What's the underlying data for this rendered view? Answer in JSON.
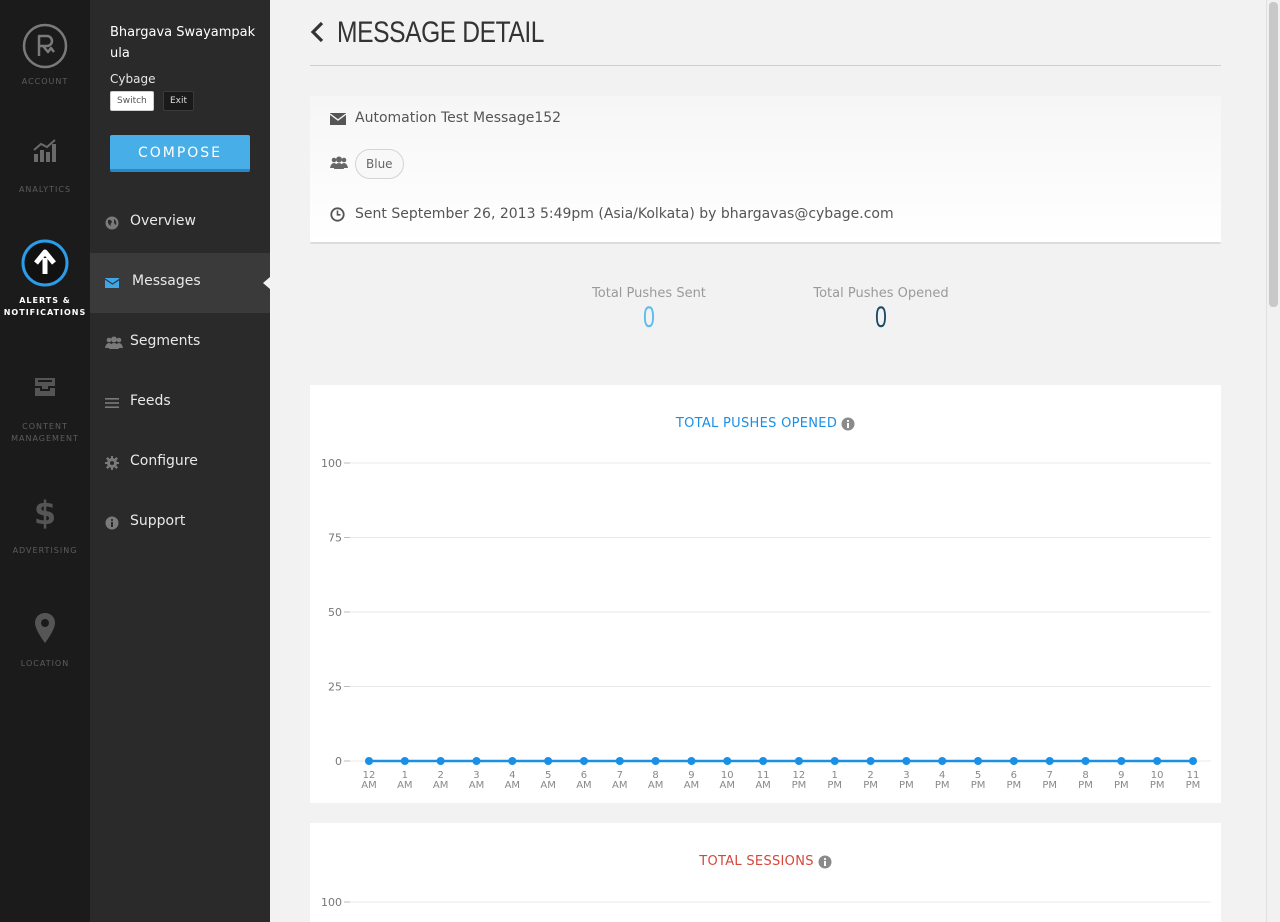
{
  "rail": [
    {
      "label": "Account",
      "icon": "brand-logo-icon",
      "active": false
    },
    {
      "label": "Analytics",
      "icon": "analytics-icon",
      "active": false
    },
    {
      "label": "Alerts &",
      "label2": "Notifications",
      "icon": "upload-arrow-icon",
      "active": true
    },
    {
      "label": "Content",
      "label2": "Management",
      "icon": "inbox-icon",
      "active": false
    },
    {
      "label": "Advertising",
      "icon": "dollar-icon",
      "active": false
    },
    {
      "label": "Location",
      "icon": "map-pin-icon",
      "active": false
    }
  ],
  "user": {
    "name": "Bhargava Swayampakula",
    "org": "Cybage",
    "switch_label": "Switch",
    "exit_label": "Exit"
  },
  "compose_label": "COMPOSE",
  "nav": [
    {
      "label": "Overview",
      "icon": "globe-icon"
    },
    {
      "label": "Messages",
      "icon": "envelope-icon",
      "active": true
    },
    {
      "label": "Segments",
      "icon": "group-icon"
    },
    {
      "label": "Feeds",
      "icon": "list-icon"
    },
    {
      "label": "Configure",
      "icon": "gear-icon"
    },
    {
      "label": "Support",
      "icon": "info-circle-icon"
    }
  ],
  "page": {
    "title": "MESSAGE DETAIL"
  },
  "detail": {
    "message_name": "Automation Test Message152",
    "segment": "Blue",
    "sent_text": "Sent September 26, 2013  5:49pm (Asia/Kolkata) by bhargavas@cybage.com"
  },
  "stats": {
    "sent_label": "Total Pushes Sent",
    "sent_value": "0",
    "opened_label": "Total Pushes Opened",
    "opened_value": "0"
  },
  "colors": {
    "accent": "#48aee8",
    "series": "#1a8fe6",
    "sessions_title": "#d6463a",
    "opened_value": "#1e4a66",
    "sent_value": "#5bbcee"
  },
  "chart_data": [
    {
      "type": "line",
      "title": "TOTAL PUSHES OPENED",
      "ylim": [
        0,
        100
      ],
      "yticks": [
        "0",
        "25",
        "50",
        "75",
        "100"
      ],
      "x": [
        [
          "12",
          "AM"
        ],
        [
          "1",
          "AM"
        ],
        [
          "2",
          "AM"
        ],
        [
          "3",
          "AM"
        ],
        [
          "4",
          "AM"
        ],
        [
          "5",
          "AM"
        ],
        [
          "6",
          "AM"
        ],
        [
          "7",
          "AM"
        ],
        [
          "8",
          "AM"
        ],
        [
          "9",
          "AM"
        ],
        [
          "10",
          "AM"
        ],
        [
          "11",
          "AM"
        ],
        [
          "12",
          "PM"
        ],
        [
          "1",
          "PM"
        ],
        [
          "2",
          "PM"
        ],
        [
          "3",
          "PM"
        ],
        [
          "4",
          "PM"
        ],
        [
          "5",
          "PM"
        ],
        [
          "6",
          "PM"
        ],
        [
          "7",
          "PM"
        ],
        [
          "8",
          "PM"
        ],
        [
          "9",
          "PM"
        ],
        [
          "10",
          "PM"
        ],
        [
          "11",
          "PM"
        ]
      ],
      "values": [
        0,
        0,
        0,
        0,
        0,
        0,
        0,
        0,
        0,
        0,
        0,
        0,
        0,
        0,
        0,
        0,
        0,
        0,
        0,
        0,
        0,
        0,
        0,
        0
      ],
      "grid": true
    },
    {
      "type": "line",
      "title": "TOTAL SESSIONS",
      "ylim": [
        0,
        100
      ],
      "yticks": [
        "100"
      ],
      "grid": true
    }
  ]
}
